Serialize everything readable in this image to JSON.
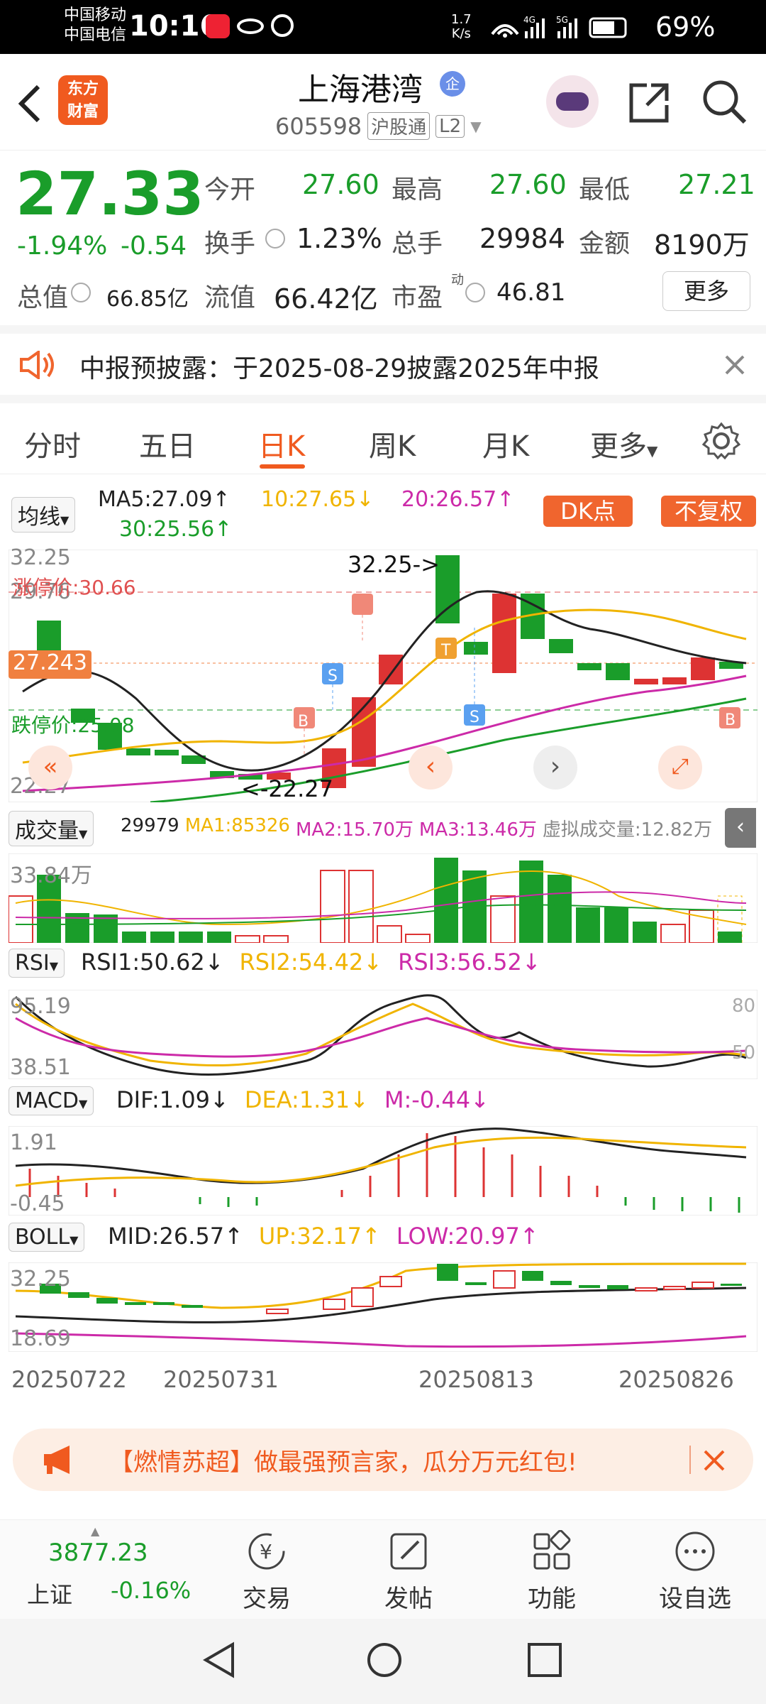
{
  "status_bar": {
    "carrier1": "中国移动",
    "carrier2": "中国电信",
    "time": "10:16",
    "speed_value": "1.7",
    "speed_unit": "K/s",
    "battery": "69%"
  },
  "header": {
    "stock_name": "上海港湾",
    "badge": "企",
    "code": "605598",
    "tag1": "沪股通",
    "tag2": "L2",
    "logo_line1": "东方",
    "logo_line2": "财富"
  },
  "quote": {
    "price": "27.33",
    "change_pct": "-1.94%",
    "change": "-0.54",
    "open_label": "今开",
    "open": "27.60",
    "high_label": "最高",
    "high": "27.60",
    "low_label": "最低",
    "low": "27.21",
    "turnover_label": "换手",
    "turnover": "1.23%",
    "volume_label": "总手",
    "volume": "29984",
    "amount_label": "金额",
    "amount": "8190万",
    "mktcap_label": "总值",
    "mktcap": "66.85亿",
    "float_label": "流值",
    "float_value": "66.42亿",
    "pe_label": "市盈",
    "pe_sup": "动",
    "pe": "46.81",
    "more_button": "更多"
  },
  "notice": {
    "text": "中报预披露：于2025-08-29披露2025年中报"
  },
  "tabs": [
    "分时",
    "五日",
    "日K",
    "周K",
    "月K",
    "更多"
  ],
  "active_tab": 2,
  "ma_bar": {
    "selector": "均线",
    "ma5": "MA5:27.09",
    "ma10": "10:27.65",
    "ma20": "20:26.57",
    "ma30": "30:25.56",
    "dk_button": "DK点",
    "fq_button": "不复权",
    "colors": {
      "ma5": "#222222",
      "ma10": "#f0b400",
      "ma20": "#cc2aa8",
      "ma30": "#1a9d2a"
    }
  },
  "kline": {
    "axis_top": "32.25",
    "axis_mid": "29.76",
    "axis_cur": "27.243",
    "axis_bottom": "22.27",
    "limit_up": "涨停价:30.66",
    "limit_down": "跌停价:25.08",
    "high_annotation": "32.25->",
    "low_annotation": "<-22.27",
    "markers": [
      "B",
      "S",
      "B",
      "T",
      "S",
      "B"
    ],
    "candles_shown": 26
  },
  "volume": {
    "selector": "成交量",
    "vol": "29979",
    "ma1": "MA1:85326",
    "ma2": "MA2:15.70万",
    "ma3": "MA3:13.46万",
    "virtual": "虚拟成交量:12.82万",
    "axis_top": "33.84万"
  },
  "rsi": {
    "selector": "RSI",
    "rsi1": "RSI1:50.62",
    "rsi2": "RSI2:54.42",
    "rsi3": "RSI3:56.52",
    "axis_top": "95.19",
    "axis_bottom": "38.51",
    "right_top": "80",
    "right_bottom": "50"
  },
  "macd": {
    "selector": "MACD",
    "dif": "DIF:1.09",
    "dea": "DEA:1.31",
    "m": "M:-0.44",
    "axis_top": "1.91",
    "axis_bottom": "-0.45"
  },
  "boll": {
    "selector": "BOLL",
    "mid": "MID:26.57",
    "up": "UP:32.17",
    "low": "LOW:20.97",
    "axis_top": "32.25",
    "axis_bottom": "18.69"
  },
  "dates": [
    "20250722",
    "20250731",
    "20250813",
    "20250826"
  ],
  "banner": {
    "text": "【燃情苏超】做最强预言家，瓜分万元红包!"
  },
  "bottom_nav": {
    "index_value": "3877.23",
    "index_name": "上证",
    "index_change": "-0.16%",
    "items": [
      "交易",
      "发帖",
      "功能",
      "设自选"
    ]
  }
}
